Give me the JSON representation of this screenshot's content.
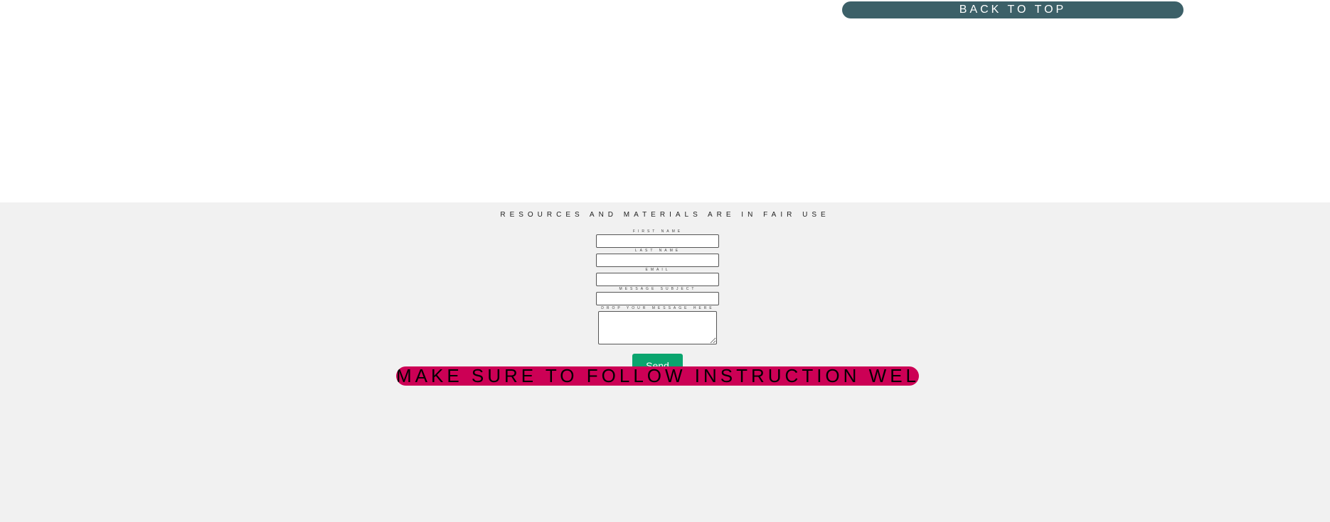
{
  "header": {
    "back_to_top_label": "BACK TO TOP"
  },
  "footer": {
    "fair_use_text": "RESOURCES AND MATERIALS ARE IN FAIR USE",
    "form": {
      "first_name_label": "FIRST NAME",
      "last_name_label": "LAST NAME",
      "email_label": "EMAIL",
      "subject_label": "MESSAGE SUBJECT",
      "message_label": "DROP YOUR MESSAGE HERE",
      "first_name_value": "",
      "last_name_value": "",
      "email_value": "",
      "subject_value": "",
      "message_value": "",
      "send_label": "Send"
    },
    "banner_text": "MAKE SURE TO FOLLOW INSTRUCTION WELL!"
  },
  "colors": {
    "back_to_top_bg": "#3c6068",
    "footer_bg": "#f1f1f1",
    "send_button_bg": "#0aa56e",
    "banner_bg": "#cc0055"
  }
}
